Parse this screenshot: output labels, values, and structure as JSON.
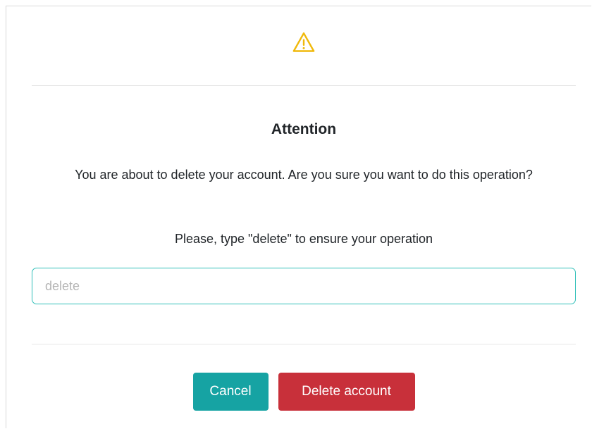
{
  "dialog": {
    "icon": "warning-triangle-icon",
    "title": "Attention",
    "message": "You are about to delete your account. Are you sure you want to do this operation?",
    "instruction": "Please, type \"delete\" to ensure your operation",
    "input": {
      "value": "",
      "placeholder": "delete"
    },
    "buttons": {
      "cancel_label": "Cancel",
      "delete_label": "Delete account"
    }
  },
  "colors": {
    "warning_icon": "#f0b90b",
    "input_border": "#2fbfb8",
    "cancel_button": "#16a3a3",
    "delete_button": "#c8303a"
  }
}
